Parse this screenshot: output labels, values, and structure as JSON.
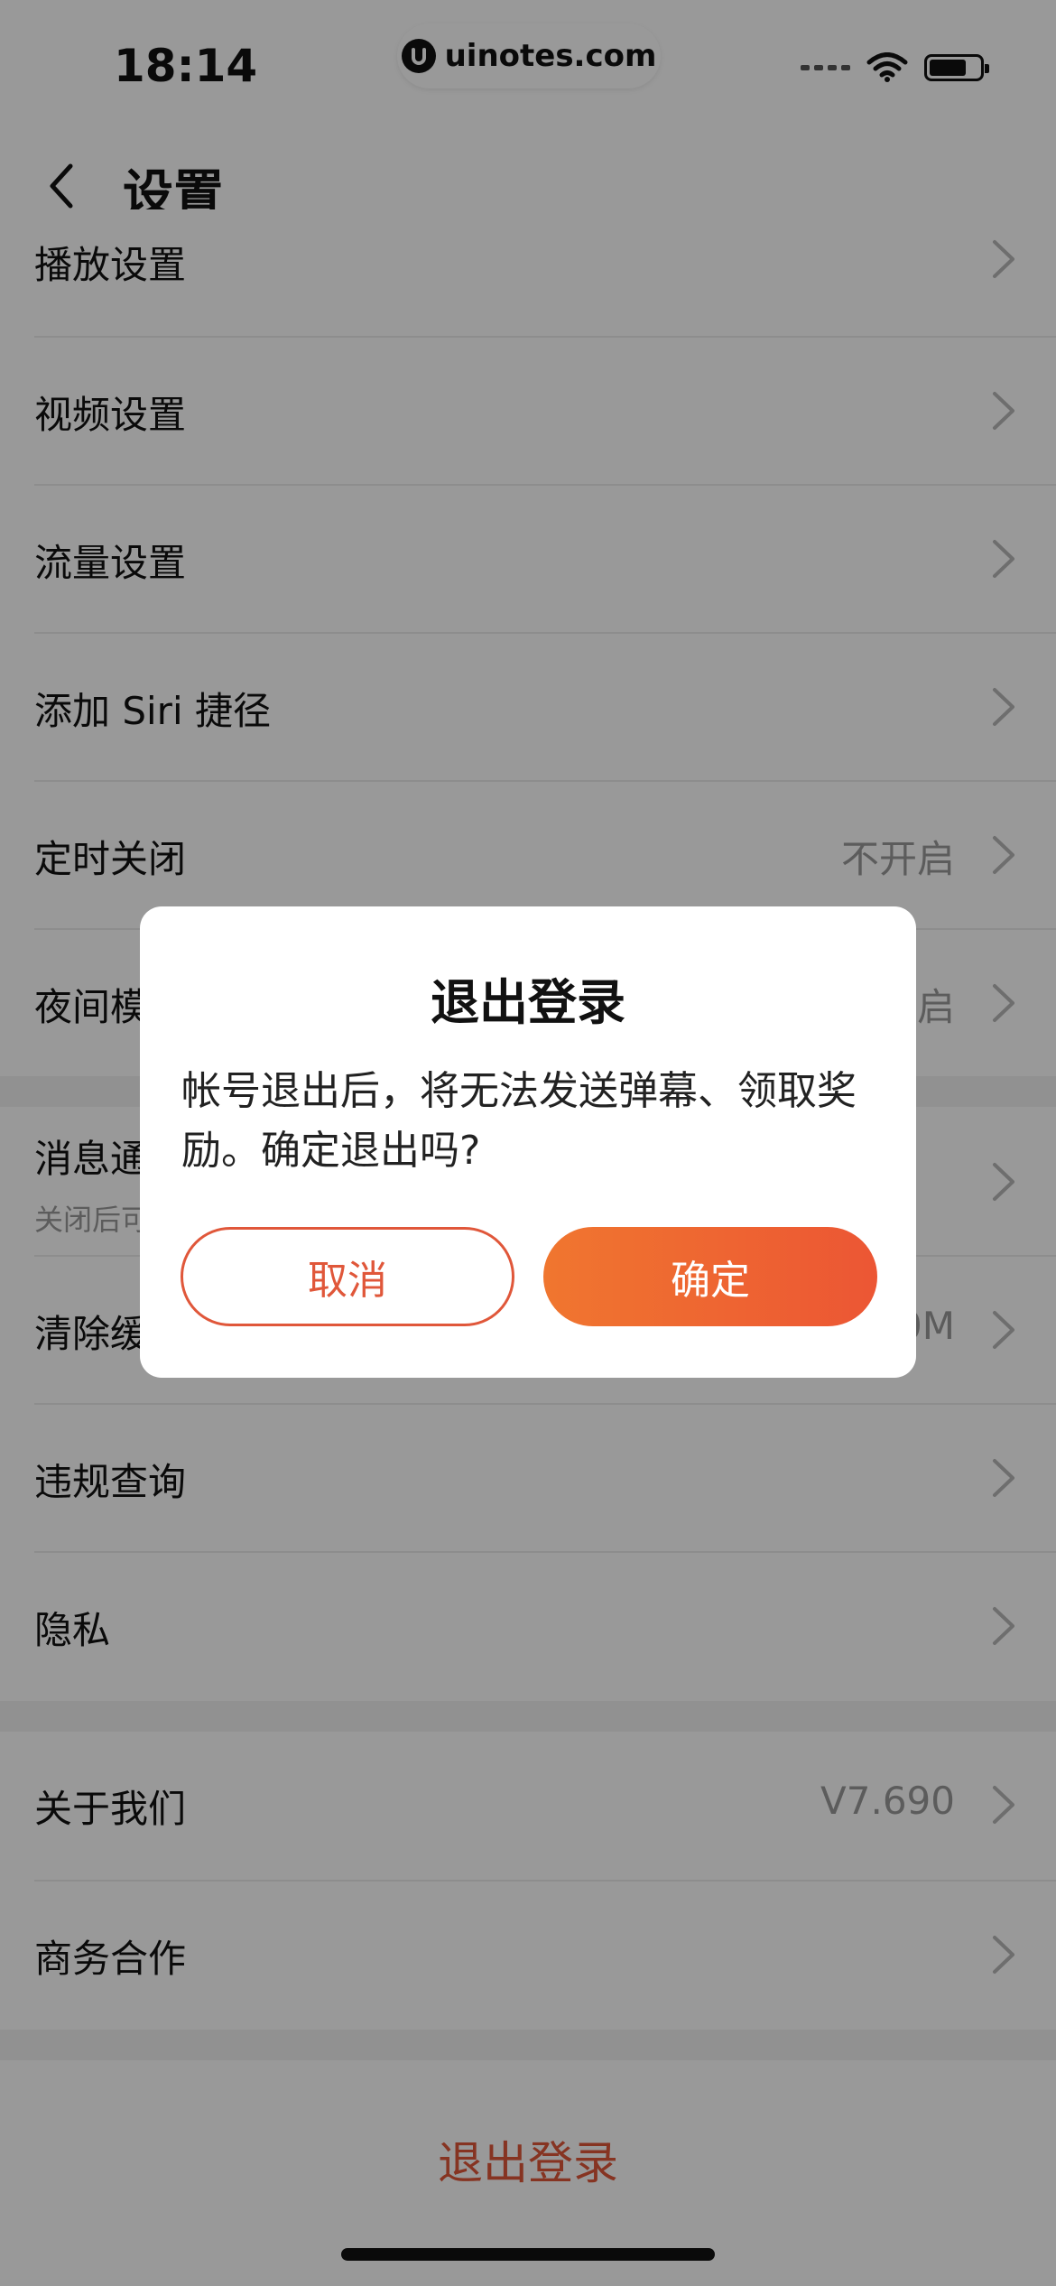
{
  "status_bar": {
    "time": "18:14",
    "url": "uinotes.com",
    "icons": [
      "cellular-signal-icon",
      "wifi-icon",
      "battery-icon"
    ]
  },
  "header": {
    "title": "设置",
    "back_icon": "chevron-left-icon"
  },
  "settings": {
    "items": [
      {
        "label": "播放设置"
      },
      {
        "label": "视频设置"
      },
      {
        "label": "流量设置"
      },
      {
        "label": "添加 Siri 捷径"
      },
      {
        "label": "定时关闭",
        "value": "不开启"
      },
      {
        "label": "夜间模式",
        "value": "不开启"
      },
      {
        "label": "消息通知",
        "sub": "关闭后可能错过重要消息"
      },
      {
        "label": "清除缓存",
        "value": "0.0M"
      },
      {
        "label": "违规查询"
      },
      {
        "label": "隐私"
      },
      {
        "label": "关于我们",
        "value": "V7.690"
      },
      {
        "label": "商务合作"
      }
    ],
    "logout_label": "退出登录"
  },
  "dialog": {
    "title": "退出登录",
    "message": "帐号退出后，将无法发送弹幕、领取奖励。确定退出吗?",
    "cancel_label": "取消",
    "confirm_label": "确定"
  },
  "colors": {
    "accent": "#e0573a",
    "confirm_gradient_start": "#f0762f",
    "confirm_gradient_end": "#ec5634",
    "overlay": "rgba(0,0,0,0.40)"
  }
}
